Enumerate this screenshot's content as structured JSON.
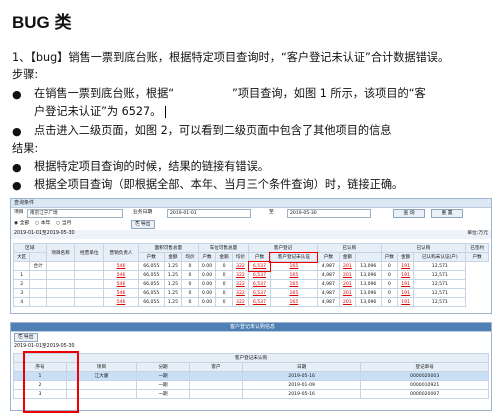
{
  "doc": {
    "title": "BUG 类",
    "issue_line": "1、【bug】销售一票到底台账，根据特定项目查询时，“客户登记未认证”合计数据错误。",
    "steps_label": "步骤:",
    "step1a": "在销售一票到底台账，根据“",
    "step1b": "”项目查询，如图 1 所示，该项目的“客",
    "step1c": "户登记未认证”为 6527。",
    "step2": "点击进入二级页面，如图 2，可以看到二级页面中包含了其他项目的信息",
    "result_label": "结果:",
    "result1": "根据特定项目查询的时候，结果的链接有错误。",
    "result2": "根据全项目查询（即根据全部、本年、当月三个条件查询）时，链接正确。"
  },
  "shot1": {
    "title": "查询条件",
    "project_label": "项目",
    "project_value": "南京江宁广场",
    "date_label": "业务日期",
    "date_from": "2019-01-01",
    "date_to_label": "至",
    "date_to": "2019-05-30",
    "query_btn": "查 询",
    "reset_btn": "重 置",
    "radio_all": "全部",
    "radio_year": "本年",
    "radio_month": "当月",
    "export_btn": "导出",
    "range": "2019-01-01至2019-05-30",
    "unit": "单位:万元",
    "headers_top": [
      "区域",
      "项目名称",
      "经营单位",
      "营销负责人",
      "面积可售总量",
      "",
      "",
      "车位可售总量",
      "",
      "",
      "客户登记",
      "",
      "已认购",
      "",
      "",
      "已认购",
      "",
      "",
      "已签约"
    ],
    "headers_sub": [
      "大区",
      "",
      "",
      "",
      "户数",
      "金额",
      "均价",
      "户数",
      "金额",
      "均价",
      "户数",
      "客户登记未认证",
      "户数",
      "金额",
      "",
      "户数",
      "金额",
      "已认购未认证(户)",
      "户数",
      "金额"
    ],
    "rows": [
      [
        "",
        "合计",
        "",
        "",
        "546",
        "66,055",
        "1.25",
        "0",
        "0.00",
        "0",
        "322",
        "6,537",
        "165",
        "4,987",
        "201",
        "13,096",
        "0",
        "191",
        "12,571"
      ],
      [
        "1",
        "",
        "",
        "",
        "546",
        "66,055",
        "1.25",
        "0",
        "0.00",
        "0",
        "322",
        "6,537",
        "165",
        "4,987",
        "201",
        "13,096",
        "0",
        "191",
        "12,571"
      ],
      [
        "2",
        "",
        "",
        "",
        "546",
        "66,055",
        "1.25",
        "0",
        "0.00",
        "0",
        "322",
        "6,537",
        "165",
        "4,987",
        "201",
        "13,096",
        "0",
        "191",
        "12,571"
      ],
      [
        "3",
        "",
        "",
        "",
        "546",
        "66,055",
        "1.25",
        "0",
        "0.00",
        "0",
        "322",
        "6,537",
        "165",
        "4,987",
        "201",
        "13,096",
        "0",
        "191",
        "12,571"
      ],
      [
        "4",
        "",
        "",
        "",
        "546",
        "66,055",
        "1.25",
        "0",
        "0.00",
        "0",
        "322",
        "6,537",
        "165",
        "4,987",
        "201",
        "13,096",
        "0",
        "191",
        "12,571"
      ]
    ]
  },
  "shot2": {
    "title": "客户登记未认购信息",
    "export_btn": "导出",
    "range": "2019-01-01至2019-05-30",
    "table_title": "客户登记未认购",
    "headers": [
      "序号",
      "项目",
      "分期",
      "客户",
      "日期",
      "登记单号"
    ],
    "rows": [
      [
        "1",
        "江大厦",
        "一期",
        "",
        "2019-05-16",
        "0000020003"
      ],
      [
        "2",
        "",
        "一期",
        "",
        "2019-01-09",
        "0000010921"
      ],
      [
        "3",
        "",
        "一期",
        "",
        "2019-05-16",
        "0000020007"
      ]
    ]
  }
}
